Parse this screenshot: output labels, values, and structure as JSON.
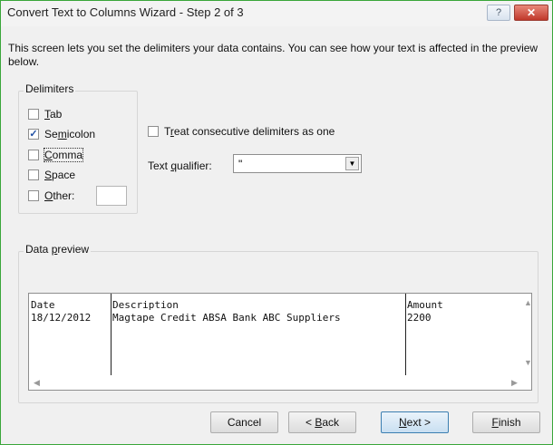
{
  "window": {
    "title": "Convert Text to Columns Wizard - Step 2 of 3",
    "help_glyph": "?",
    "close_glyph": "✕"
  },
  "intro_text": "This screen lets you set the delimiters your data contains.  You can see how your text is affected in the preview below.",
  "delimiters": {
    "legend": "Delimiters",
    "tab": {
      "label": "Tab",
      "checked": false
    },
    "semicolon": {
      "label": "Semicolon",
      "checked": true
    },
    "comma": {
      "label": "Comma",
      "checked": false
    },
    "space": {
      "label": "Space",
      "checked": false
    },
    "other": {
      "label": "Other:",
      "checked": false,
      "value": ""
    }
  },
  "consecutive": {
    "label": "Treat consecutive delimiters as one",
    "checked": false
  },
  "text_qualifier": {
    "label": "Text qualifier:",
    "value": "\""
  },
  "preview": {
    "legend": "Data preview",
    "columns": [
      {
        "cells": [
          "Date",
          "18/12/2012"
        ]
      },
      {
        "cells": [
          "Description",
          "Magtape Credit ABSA Bank ABC Suppliers"
        ]
      },
      {
        "cells": [
          "Amount",
          "2200"
        ]
      }
    ]
  },
  "buttons": {
    "cancel": "Cancel",
    "back": "< Back",
    "next": "Next >",
    "finish": "Finish"
  },
  "colors": {
    "window_border": "#3aa63a",
    "close_button": "#c0392b",
    "check_mark": "#1f4fa3"
  }
}
